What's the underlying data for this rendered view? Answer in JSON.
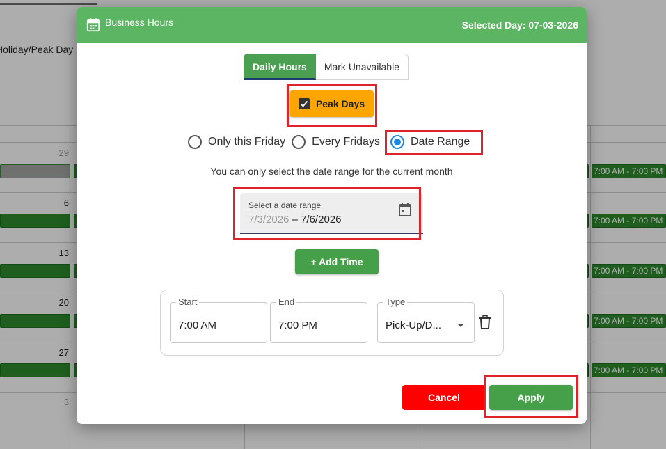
{
  "background": {
    "label_partial": "Holiday/Peak Day",
    "left_day_numbers": [
      "29",
      "6",
      "13",
      "20",
      "27",
      "3"
    ],
    "event_label": "7:00 AM - 7:00 PM",
    "right_events": [
      "7:00 AM - 7:00 PM",
      "7:00 AM - 7:00 PM",
      "7:00 AM - 7:00 PM",
      "7:00 AM - 7:00 PM",
      "7:00 AM - 7:00 PM"
    ]
  },
  "dialog": {
    "title": "Business Hours",
    "selected_day": "Selected Day: 07-03-2026",
    "tabs": [
      {
        "label": "Daily Hours",
        "active": true
      },
      {
        "label": "Mark Unavailable",
        "active": false
      }
    ],
    "peak_days": {
      "label": "Peak Days",
      "checked": true
    },
    "radio_options": [
      {
        "label": "Only this Friday",
        "selected": false
      },
      {
        "label": "Every Fridays",
        "selected": false
      },
      {
        "label": "Date Range",
        "selected": true
      }
    ],
    "hint": "You can only select the date range for the current month",
    "date_range": {
      "label": "Select a date range",
      "start": "7/3/2026",
      "separator": " – ",
      "end": "7/6/2026",
      "icon": "calendar-icon"
    },
    "add_time_label": "+ Add Time",
    "time_row": {
      "start_label": "Start",
      "start_value": "7:00 AM",
      "end_label": "End",
      "end_value": "7:00 PM",
      "type_label": "Type",
      "type_value": "Pick-Up/D...",
      "delete_icon": "trash-icon"
    },
    "cancel_label": "Cancel",
    "apply_label": "Apply"
  },
  "colors": {
    "header_green": "#5cb562",
    "button_green": "#45a049",
    "peak_orange": "#ffa500",
    "cancel_red": "#ff0000",
    "radio_blue": "#1e88e5",
    "highlight_red": "#e0222a"
  }
}
